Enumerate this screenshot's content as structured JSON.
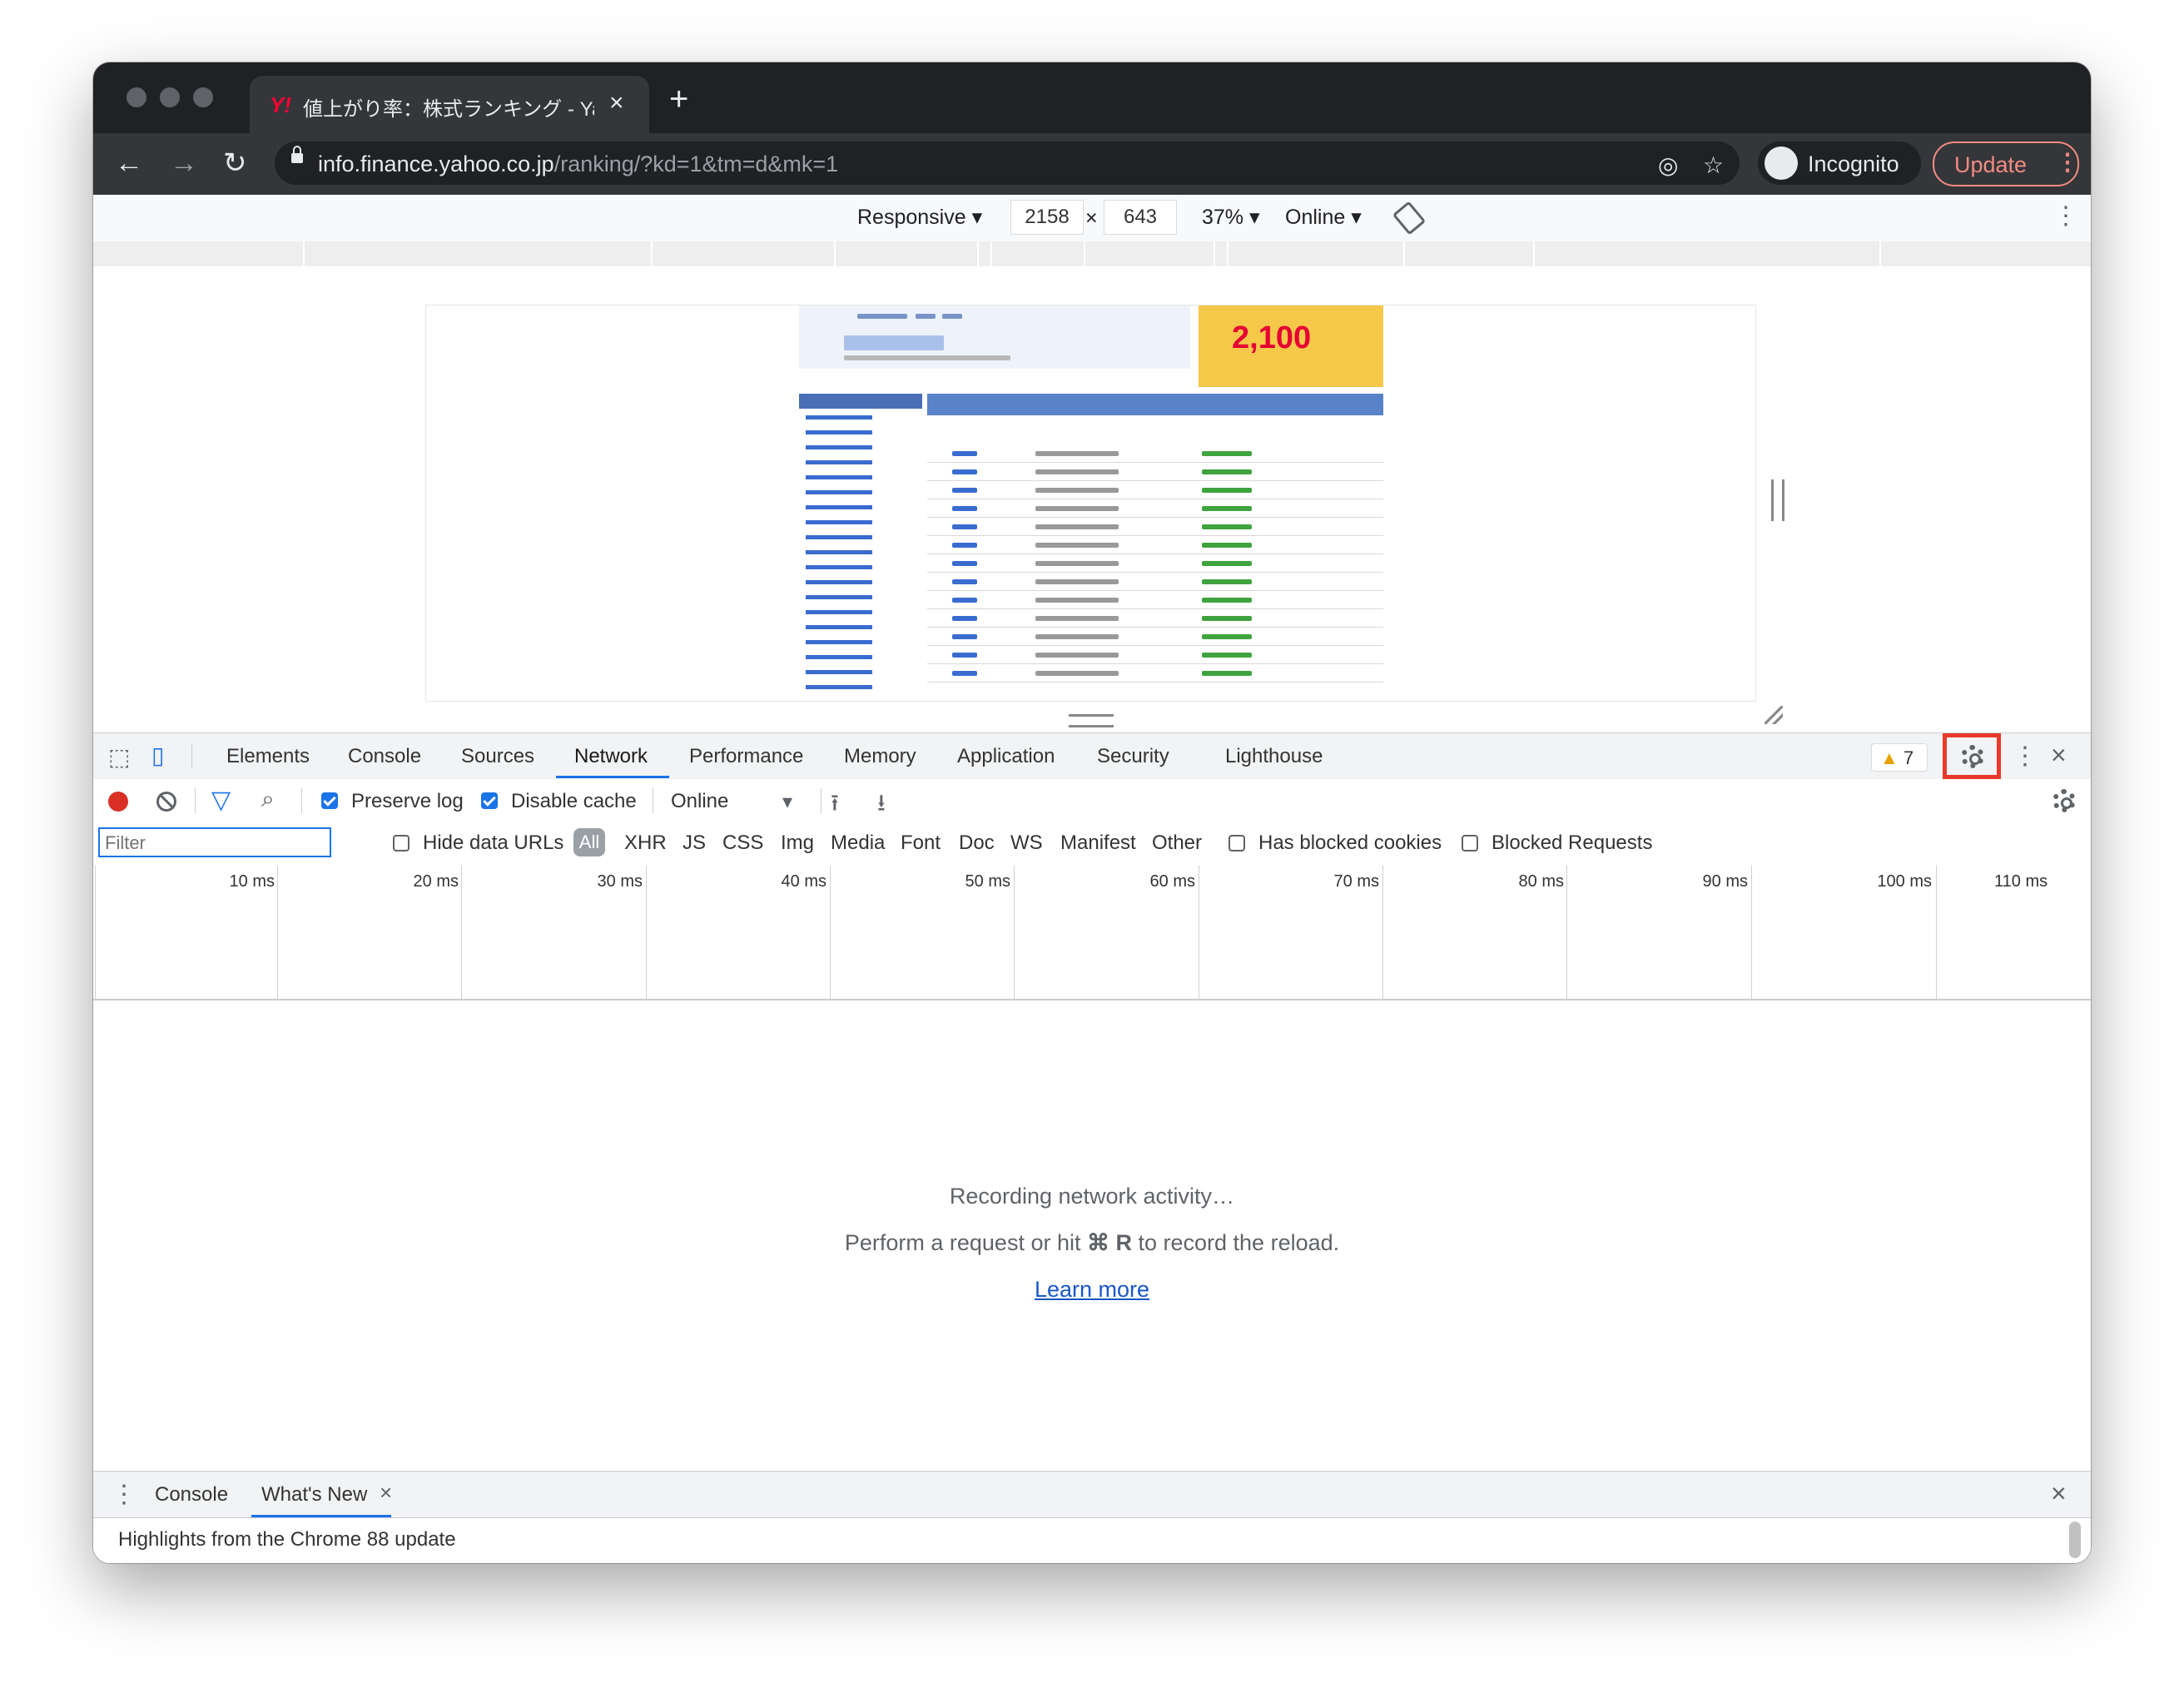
{
  "browser": {
    "tab_title": "値上がり率：株式ランキング - Yahoo!ファイナンス",
    "url_host": "info.finance.yahoo.co.jp",
    "url_path": "/ranking/?kd=1&tm=d&mk=1",
    "incognito_label": "Incognito",
    "update_label": "Update"
  },
  "device_toolbar": {
    "mode": "Responsive",
    "width": "2158",
    "height": "643",
    "zoom": "37%",
    "network": "Online"
  },
  "embedded_page": {
    "ad_text": "2,100"
  },
  "devtools": {
    "tabs": [
      "Elements",
      "Console",
      "Sources",
      "Network",
      "Performance",
      "Memory",
      "Application",
      "Security",
      "Lighthouse"
    ],
    "active_tab": "Network",
    "warnings_count": "7",
    "toolbar": {
      "preserve_log": "Preserve log",
      "preserve_log_checked": true,
      "disable_cache": "Disable cache",
      "disable_cache_checked": true,
      "throttling": "Online"
    },
    "filter": {
      "placeholder": "Filter",
      "hide_data_urls": "Hide data URLs",
      "types": [
        "All",
        "XHR",
        "JS",
        "CSS",
        "Img",
        "Media",
        "Font",
        "Doc",
        "WS",
        "Manifest",
        "Other"
      ],
      "has_blocked_cookies": "Has blocked cookies",
      "blocked_requests": "Blocked Requests"
    },
    "timeline_labels": [
      "10 ms",
      "20 ms",
      "30 ms",
      "40 ms",
      "50 ms",
      "60 ms",
      "70 ms",
      "80 ms",
      "90 ms",
      "100 ms",
      "110 ms"
    ],
    "empty_state": {
      "line1": "Recording network activity…",
      "line2_prefix": "Perform a request or hit ",
      "line2_key": "⌘ R",
      "line2_suffix": " to record the reload.",
      "link": "Learn more"
    },
    "drawer": {
      "tabs": [
        "Console",
        "What's New"
      ],
      "active_tab": "What's New",
      "content": "Highlights from the Chrome 88 update"
    }
  },
  "colors": {
    "accent": "#1a73e8",
    "record": "#d93025",
    "highlight_box": "#e8392b"
  }
}
